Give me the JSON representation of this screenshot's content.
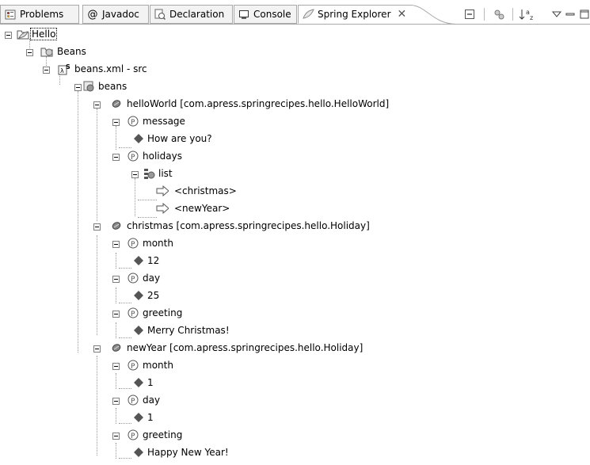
{
  "tabs": [
    {
      "label": "Problems",
      "icon": "problems-icon"
    },
    {
      "label": "Javadoc",
      "icon": "at-icon"
    },
    {
      "label": "Declaration",
      "icon": "declaration-icon"
    },
    {
      "label": "Console",
      "icon": "console-icon"
    },
    {
      "label": "Spring Explorer",
      "icon": "spring-leaf-icon",
      "active": true
    }
  ],
  "tree": {
    "root": "Hello",
    "beans_folder": "Beans",
    "file": "beans.xml - src",
    "beans": "beans",
    "helloWorld": "helloWorld [com.apress.springrecipes.hello.HelloWorld]",
    "message": "message",
    "message_value": "How are you?",
    "holidays": "holidays",
    "list": "list",
    "ref1": "<christmas>",
    "ref2": "<newYear>",
    "christmas": "christmas [com.apress.springrecipes.hello.Holiday]",
    "c_month": "month",
    "c_month_val": "12",
    "c_day": "day",
    "c_day_val": "25",
    "c_greeting": "greeting",
    "c_greeting_val": "Merry Christmas!",
    "newYear": "newYear [com.apress.springrecipes.hello.Holiday]",
    "n_month": "month",
    "n_month_val": "1",
    "n_day": "day",
    "n_day_val": "1",
    "n_greeting": "greeting",
    "n_greeting_val": "Happy New Year!"
  }
}
